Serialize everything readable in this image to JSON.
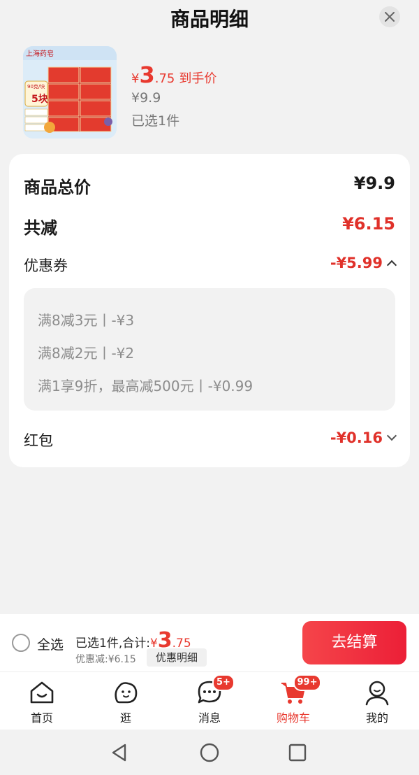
{
  "header": {
    "title": "商品明细",
    "close_icon": "close-icon"
  },
  "product": {
    "image_icon": "product-thumbnail",
    "price_currency": "¥",
    "price_integer": "3",
    "price_decimal": ".75",
    "price_tag": "到手价",
    "original_price": "¥9.9",
    "selected_count": "已选1件"
  },
  "summary": {
    "total_label": "商品总价",
    "total_value": "¥9.9",
    "reduce_label": "共减",
    "reduce_value": "¥6.15",
    "coupon_label": "优惠券",
    "coupon_value": "-¥5.99",
    "coupon_items": [
      "满8减3元丨-¥3",
      "满8减2元丨-¥2",
      "满1享9折，最高减500元丨-¥0.99"
    ],
    "redpacket_label": "红包",
    "redpacket_value": "-¥0.16"
  },
  "bottom_bar": {
    "select_all": "全选",
    "summary_prefix": "已选1件,合计:",
    "currency": "¥",
    "total_integer": "3",
    "total_decimal": ".75",
    "discount_text": "优惠减:¥6.15",
    "detail_button": "优惠明细",
    "checkout_button": "去结算"
  },
  "tabbar": {
    "tabs": [
      {
        "label": "首页",
        "icon": "home-icon"
      },
      {
        "label": "逛",
        "icon": "browse-icon"
      },
      {
        "label": "消息",
        "icon": "message-icon",
        "badge": "5+"
      },
      {
        "label": "购物车",
        "icon": "cart-icon",
        "badge": "99+",
        "active": true
      },
      {
        "label": "我的",
        "icon": "profile-icon"
      }
    ]
  },
  "colors": {
    "accent": "#e8392f",
    "background": "#f2f2f2"
  }
}
